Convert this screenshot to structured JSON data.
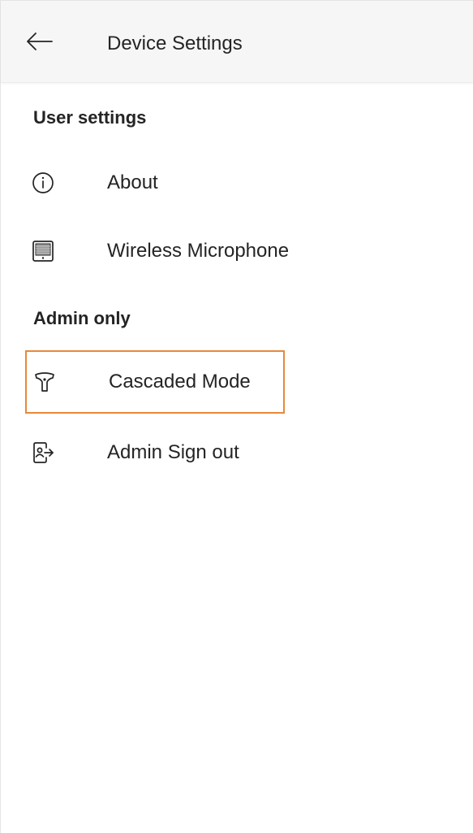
{
  "header": {
    "title": "Device Settings",
    "back_icon": "arrow-left-icon"
  },
  "sections": [
    {
      "title": "User settings",
      "items": [
        {
          "label": "About",
          "icon": "info-icon"
        },
        {
          "label": "Wireless Microphone",
          "icon": "wireless-microphone-icon"
        }
      ]
    },
    {
      "title": "Admin only",
      "items": [
        {
          "label": "Cascaded Mode",
          "icon": "cascade-icon",
          "highlighted": true
        },
        {
          "label": "Admin Sign out",
          "icon": "sign-out-icon"
        }
      ]
    }
  ],
  "colors": {
    "highlight_border": "#e8893a",
    "header_background": "#f6f6f6",
    "text": "#242424"
  }
}
